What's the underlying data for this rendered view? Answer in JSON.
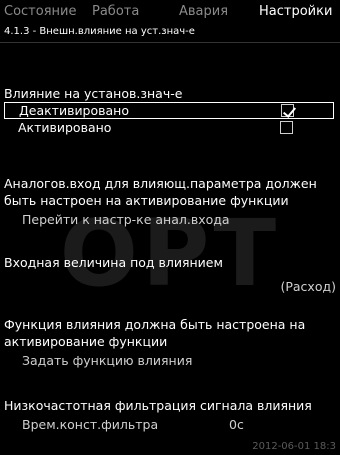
{
  "tabs": [
    {
      "label": "Состояние",
      "active": false
    },
    {
      "label": "Работа",
      "active": false
    },
    {
      "label": "Авария",
      "active": false
    },
    {
      "label": "Настройки",
      "active": true
    }
  ],
  "breadcrumb": "4.1.3 - Внешн.влияние на уст.знач-е",
  "watermark": "OPT",
  "section_influence": {
    "title": "Влияние на установ.знач-е",
    "options": [
      {
        "label": "Деактивировано",
        "checked": true,
        "selected": true
      },
      {
        "label": "Активировано",
        "checked": false,
        "selected": false
      }
    ]
  },
  "section_analog": {
    "line1": "Аналогов.вход для влияющ.параметра должен",
    "line2": "быть настроен на активирование функции",
    "link": "Перейти к настр-ке анал.входа"
  },
  "section_input": {
    "title": "Входная величина под влиянием",
    "value": "(Расход)"
  },
  "section_function": {
    "line1": "Функция влияния должна быть настроена на",
    "line2": "активирование функции",
    "link": "Задать функцию влияния"
  },
  "section_filter": {
    "title": "Низкочастотная фильтрация сигнала влияния",
    "param_label": "Врем.конст.фильтра",
    "param_value": "0с"
  },
  "timestamp": "2012-06-01 18:3"
}
